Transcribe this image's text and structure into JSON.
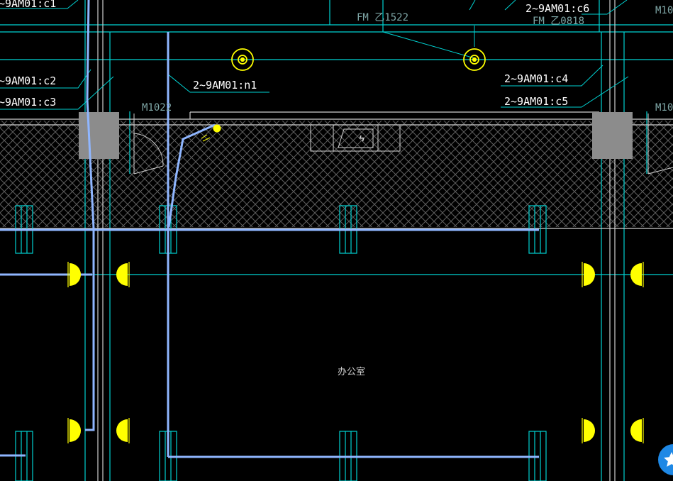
{
  "drawing": {
    "room_name": "办公室",
    "door_labels": {
      "fm_top": "FM 乙1522",
      "fm_overlap": "FM 乙0818",
      "m_left": "M1022",
      "m_right_a": "M10",
      "m_right_b": "M10"
    },
    "circuit_labels": {
      "c1": "~9AM01:c1",
      "c2": "~9AM01:c2",
      "c3": "~9AM01:c3",
      "n1": "2~9AM01:n1",
      "c4": "2~9AM01:c4",
      "c5": "2~9AM01:c5",
      "c6": "2~9AM01:c6"
    },
    "symbols": {
      "ceiling_device": "ceiling-device-icon",
      "wall_lamp": "wall-lamp-icon",
      "junction": "junction-dot-icon",
      "fab": "star-icon"
    },
    "colors": {
      "background": "#000000",
      "wall_line": "#00d2d2",
      "label_text": "#ffffff",
      "conduit": "#8fb6ff",
      "device": "#ffff00",
      "column": "#8c8c8c",
      "hatch": "#5f5f5f",
      "fab": "#1e88e5"
    }
  }
}
